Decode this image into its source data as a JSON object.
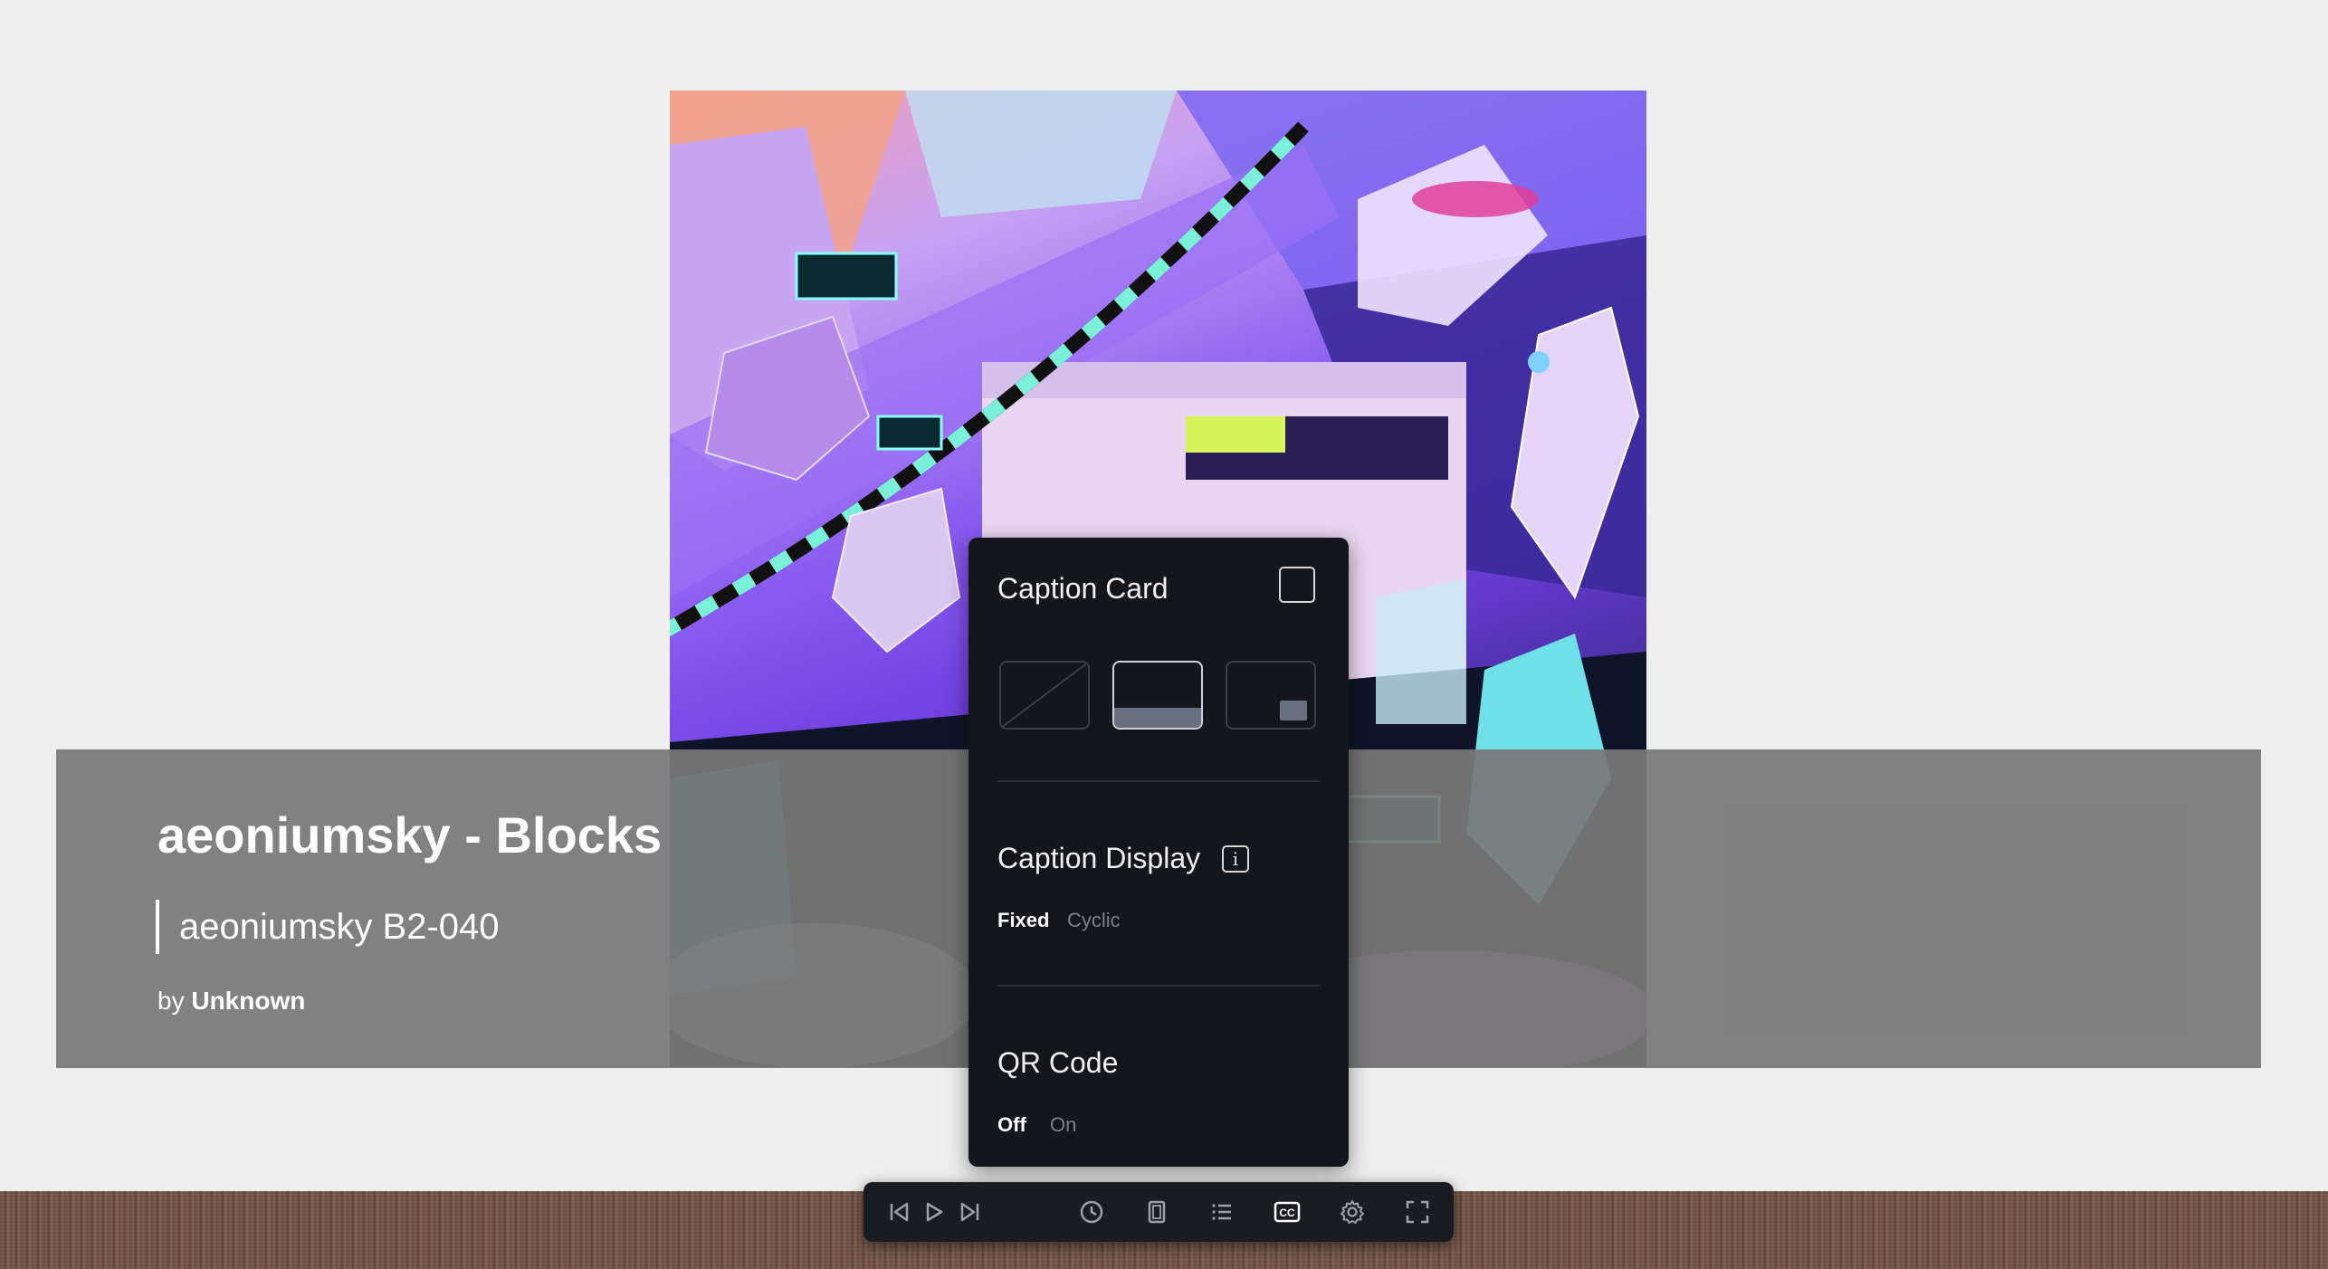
{
  "caption": {
    "title": "aeoniumsky - Blocks",
    "subtitle": "aeoniumsky B2-040",
    "by_prefix": "by",
    "artist": "Unknown"
  },
  "panel": {
    "caption_card": {
      "label": "Caption Card",
      "checked": false,
      "layouts": [
        "layout-none",
        "layout-bottom-band",
        "layout-corner-card"
      ],
      "selected_layout": "layout-bottom-band"
    },
    "caption_display": {
      "label": "Caption Display",
      "info_glyph": "i",
      "options": [
        "Fixed",
        "Cyclic"
      ],
      "selected": "Fixed"
    },
    "qr_code": {
      "label": "QR Code",
      "options": [
        "Off",
        "On"
      ],
      "selected": "Off"
    }
  },
  "toolbar": {
    "buttons": [
      "skip-previous-icon",
      "play-icon",
      "skip-next-icon",
      "clock-icon",
      "frame-icon",
      "list-icon",
      "cc-icon",
      "gear-icon",
      "fullscreen-icon"
    ],
    "active": "cc-icon",
    "cc_text": "CC"
  },
  "colors": {
    "panel_bg": "#14161c",
    "caption_band": "#787878",
    "page_bg": "#efefef",
    "inactive_text": "#7c7f88"
  }
}
